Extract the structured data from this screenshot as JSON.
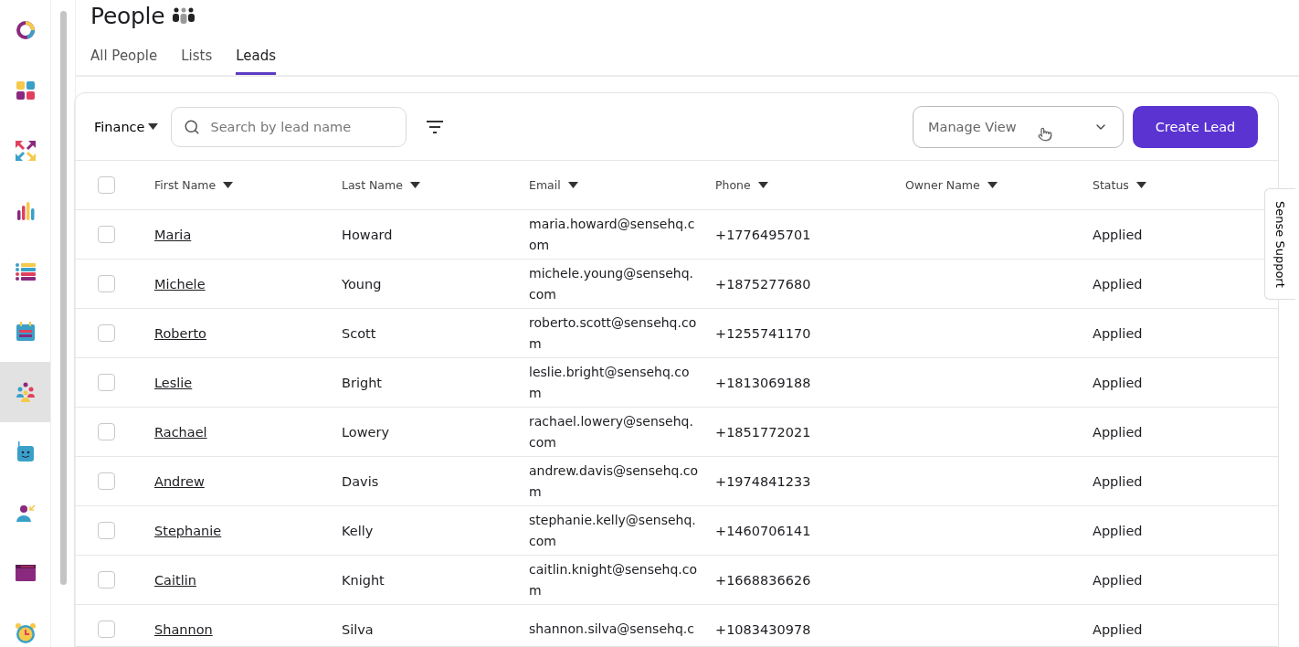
{
  "sidebar": {
    "items": [
      {
        "kind": "ring",
        "selected": false
      },
      {
        "kind": "grid",
        "selected": false
      },
      {
        "kind": "arrows",
        "selected": false
      },
      {
        "kind": "bars",
        "selected": false
      },
      {
        "kind": "list",
        "selected": false
      },
      {
        "kind": "calendar",
        "selected": false
      },
      {
        "kind": "people",
        "selected": true
      },
      {
        "kind": "robot",
        "selected": false
      },
      {
        "kind": "person",
        "selected": false
      },
      {
        "kind": "window",
        "selected": false
      },
      {
        "kind": "clock",
        "selected": false
      }
    ]
  },
  "page": {
    "title": "People"
  },
  "tabs": [
    {
      "label": "All People",
      "selected": false
    },
    {
      "label": "Lists",
      "selected": false
    },
    {
      "label": "Leads",
      "selected": true
    }
  ],
  "toolbar": {
    "group": "Finance",
    "search": {
      "placeholder": "Search by lead name"
    },
    "manage_view": {
      "placeholder": "Manage View"
    },
    "create_button": "Create Lead"
  },
  "table": {
    "select_all_checked": false,
    "columns": [
      "First Name",
      "Last Name",
      "Email",
      "Phone",
      "Owner Name",
      "Status"
    ],
    "rows": [
      {
        "checked": false,
        "first_name": "Maria",
        "last_name": "Howard",
        "email": "maria.howard@sensehq.com",
        "phone": "+1776495701",
        "status": "Applied"
      },
      {
        "checked": false,
        "first_name": "Michele",
        "last_name": "Young",
        "email": "michele.young@sensehq.com",
        "phone": "+1875277680",
        "status": "Applied"
      },
      {
        "checked": false,
        "first_name": "Roberto",
        "last_name": "Scott",
        "email": "roberto.scott@sensehq.com",
        "phone": "+1255741170",
        "status": "Applied"
      },
      {
        "checked": false,
        "first_name": "Leslie",
        "last_name": "Bright",
        "email": "leslie.bright@sensehq.com",
        "phone": "+1813069188",
        "status": "Applied"
      },
      {
        "checked": false,
        "first_name": "Rachael",
        "last_name": "Lowery",
        "email": "rachael.lowery@sensehq.com",
        "phone": "+1851772021",
        "status": "Applied"
      },
      {
        "checked": false,
        "first_name": "Andrew",
        "last_name": "Davis",
        "email": "andrew.davis@sensehq.com",
        "phone": "+1974841233",
        "status": "Applied"
      },
      {
        "checked": false,
        "first_name": "Stephanie",
        "last_name": "Kelly",
        "email": "stephanie.kelly@sensehq.com",
        "phone": "+1460706141",
        "status": "Applied"
      },
      {
        "checked": false,
        "first_name": "Caitlin",
        "last_name": "Knight",
        "email": "caitlin.knight@sensehq.com",
        "phone": "+1668836626",
        "status": "Applied"
      },
      {
        "checked": false,
        "first_name": "Shannon",
        "last_name": "Silva",
        "email": "shannon.silva@sensehq.c",
        "phone": "+1083430978",
        "status": "Applied"
      }
    ]
  },
  "support_tab": "Sense Support"
}
